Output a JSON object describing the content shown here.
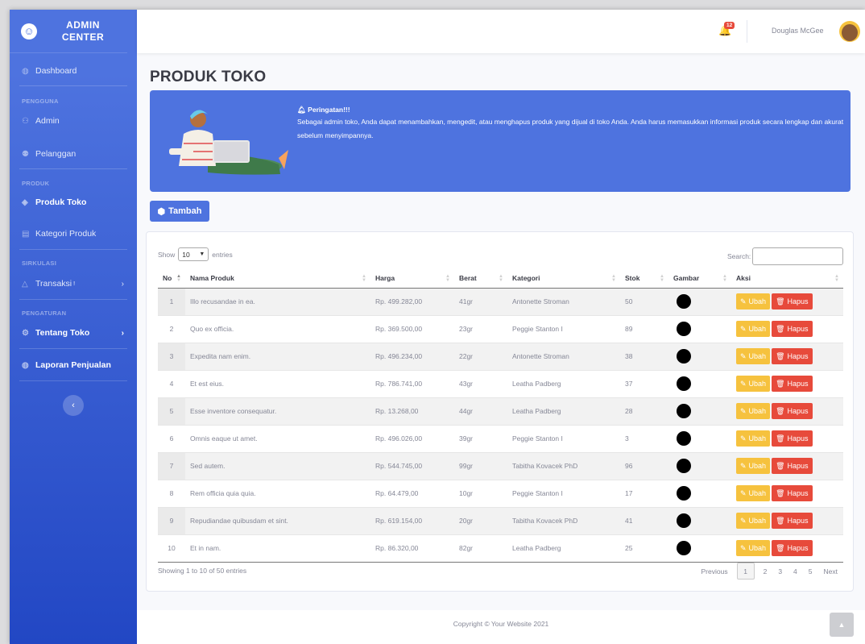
{
  "brand": {
    "line1": "ADMIN",
    "line2": "CENTER"
  },
  "sidebar": {
    "dashboard": "Dashboard",
    "head_pengguna": "PENGGUNA",
    "admin": "Admin",
    "pelanggan": "Pelanggan",
    "head_produk": "PRODUK",
    "produk_toko": "Produk Toko",
    "kategori_produk": "Kategori Produk",
    "head_sirkulasi": "SIRKULASI",
    "transaksi": "Transaksi",
    "transaksi_mark": "!",
    "head_pengaturan": "PENGATURAN",
    "tentang_toko": "Tentang Toko",
    "laporan": "Laporan Penjualan"
  },
  "topbar": {
    "alert_count": "12",
    "user_name": "Douglas McGee"
  },
  "page": {
    "title": "PRODUK TOKO"
  },
  "banner": {
    "title": "Peringatan!!!",
    "text": "Sebagai admin toko, Anda dapat menambahkan, mengedit, atau menghapus produk yang dijual di toko Anda. Anda harus memasukkan informasi produk secara lengkap dan akurat sebelum menyimpannya."
  },
  "actions": {
    "add_label": "Tambah"
  },
  "table": {
    "show_label": "Show",
    "entries_label": "entries",
    "page_size": "10",
    "search_label": "Search:",
    "columns": [
      "No",
      "Nama Produk",
      "Harga",
      "Berat",
      "Kategori",
      "Stok",
      "Gambar",
      "Aksi"
    ],
    "edit_label": "Ubah",
    "delete_label": "Hapus",
    "rows": [
      [
        "1",
        "Illo recusandae in ea.",
        "Rp. 499.282,00",
        "41gr",
        "Antonette Stroman",
        "50"
      ],
      [
        "2",
        "Quo ex officia.",
        "Rp. 369.500,00",
        "23gr",
        "Peggie Stanton I",
        "89"
      ],
      [
        "3",
        "Expedita nam enim.",
        "Rp. 496.234,00",
        "22gr",
        "Antonette Stroman",
        "38"
      ],
      [
        "4",
        "Et est eius.",
        "Rp. 786.741,00",
        "43gr",
        "Leatha Padberg",
        "37"
      ],
      [
        "5",
        "Esse inventore consequatur.",
        "Rp. 13.268,00",
        "44gr",
        "Leatha Padberg",
        "28"
      ],
      [
        "6",
        "Omnis eaque ut amet.",
        "Rp. 496.026,00",
        "39gr",
        "Peggie Stanton I",
        "3"
      ],
      [
        "7",
        "Sed autem.",
        "Rp. 544.745,00",
        "99gr",
        "Tabitha Kovacek PhD",
        "96"
      ],
      [
        "8",
        "Rem officia quia quia.",
        "Rp. 64.479,00",
        "10gr",
        "Peggie Stanton I",
        "17"
      ],
      [
        "9",
        "Repudiandae quibusdam et sint.",
        "Rp. 619.154,00",
        "20gr",
        "Tabitha Kovacek PhD",
        "41"
      ],
      [
        "10",
        "Et in nam.",
        "Rp. 86.320,00",
        "82gr",
        "Leatha Padberg",
        "25"
      ]
    ],
    "info": "Showing 1 to 10 of 50 entries",
    "pagination": {
      "previous": "Previous",
      "pages": [
        "1",
        "2",
        "3",
        "4",
        "5"
      ],
      "current": "1",
      "next": "Next"
    }
  },
  "footer": {
    "copyright": "Copyright © Your Website 2021"
  },
  "colors": {
    "primary": "#4e73df",
    "warning": "#f6c23e",
    "danger": "#e74a3b"
  }
}
